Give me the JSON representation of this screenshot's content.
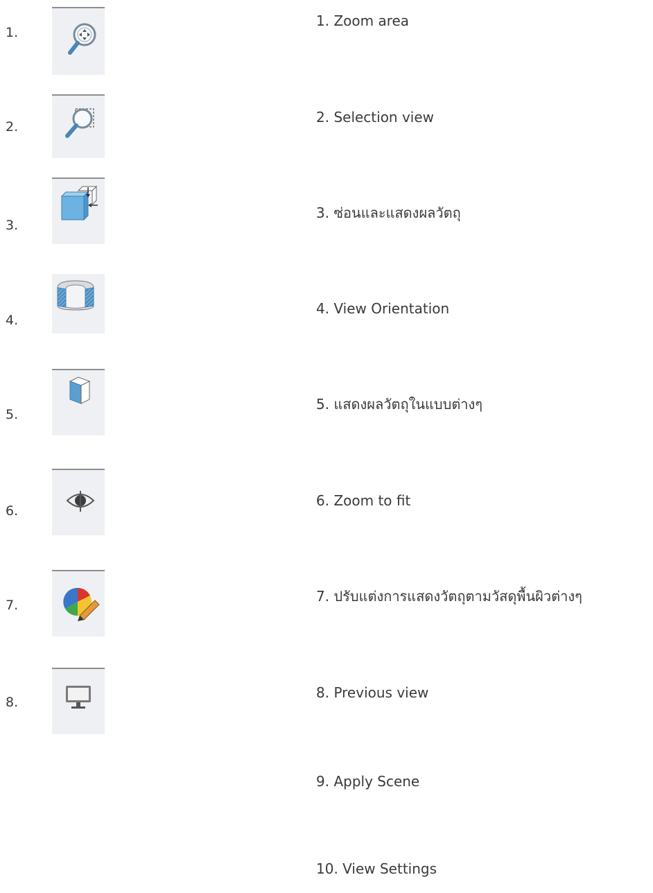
{
  "items": [
    {
      "number": "1.",
      "icon": "zoom-area-magnifier-icon",
      "label": "1. Zoom area"
    },
    {
      "number": "2.",
      "icon": "selection-view-magnifier-icon",
      "label": "2. Selection view"
    },
    {
      "number": "3.",
      "icon": "hide-show-cube-icon",
      "label": "3. ซ่อนและแสดงผลวัตถุ"
    },
    {
      "number": "4.",
      "icon": "section-view-cylinder-icon",
      "label": "4. View Orientation"
    },
    {
      "number": "5.",
      "icon": "display-style-cube-icon",
      "label": "5. แสดงผลวัตถุในแบบต่างๆ"
    },
    {
      "number": "6.",
      "icon": "eye-icon",
      "label": "6. Zoom to fit"
    },
    {
      "number": "7.",
      "icon": "appearance-ball-pencil-icon",
      "label": "7. ปรับแต่งการแสดงวัตถุตามวัสดุพื้นผิวต่างๆ"
    },
    {
      "number": "8.",
      "icon": "monitor-icon",
      "label": "8. Previous view"
    },
    {
      "label": "9. Apply Scene"
    },
    {
      "label": "10. View Settings"
    }
  ],
  "colors": {
    "tile_background": "#eef0f3",
    "tile_top_border": "#8e8e8e",
    "icon_blue": "#5a9fd0",
    "text": "#3a3a3a"
  }
}
